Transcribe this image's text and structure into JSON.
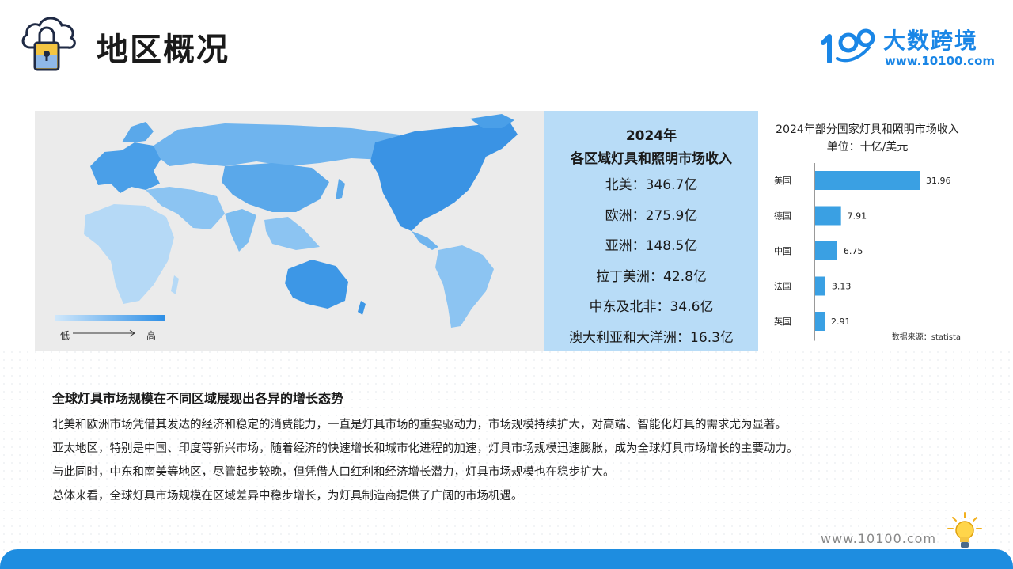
{
  "page": {
    "title": "地区概况"
  },
  "brand": {
    "name": "大数跨境",
    "url": "www.10100.com",
    "logo_text": "100"
  },
  "map": {
    "legend_low": "低",
    "legend_high": "高",
    "color_low": "#cfe7fb",
    "color_high": "#2e8fe6"
  },
  "regions": {
    "title_line1": "2024年",
    "title_line2": "各区域灯具和照明市场收入",
    "items": [
      {
        "label": "北美：346.7亿"
      },
      {
        "label": "欧洲：275.9亿"
      },
      {
        "label": "亚洲：148.5亿"
      },
      {
        "label": "拉丁美洲：42.8亿"
      },
      {
        "label": "中东及北非：34.6亿"
      },
      {
        "label": "澳大利亚和大洋洲：16.3亿"
      }
    ]
  },
  "chart_data": {
    "type": "bar",
    "orientation": "horizontal",
    "title": "2024年部分国家灯具和照明市场收入",
    "subtitle": "单位：十亿/美元",
    "categories": [
      "美国",
      "德国",
      "中国",
      "法国",
      "英国"
    ],
    "values": [
      31.96,
      7.91,
      6.75,
      3.13,
      2.91
    ],
    "value_labels": [
      "31.96",
      "7.91",
      "6.75",
      "3.13",
      "2.91"
    ],
    "source": "数据来源：statista",
    "bar_color": "#3aa0e3",
    "grid": false
  },
  "section": {
    "heading": "全球灯具市场规模在不同区域展现出各异的增长态势",
    "paragraphs": [
      "北美和欧洲市场凭借其发达的经济和稳定的消费能力，一直是灯具市场的重要驱动力，市场规模持续扩大，对高端、智能化灯具的需求尤为显著。",
      "亚太地区，特别是中国、印度等新兴市场，随着经济的快速增长和城市化进程的加速，灯具市场规模迅速膨胀，成为全球灯具市场增长的主要动力。",
      "与此同时，中东和南美等地区，尽管起步较晚，但凭借人口红利和经济增长潜力，灯具市场规模也在稳步扩大。",
      "总体来看，全球灯具市场规模在区域差异中稳步增长，为灯具制造商提供了广阔的市场机遇。"
    ]
  },
  "footer": {
    "url": "www.10100.com"
  }
}
